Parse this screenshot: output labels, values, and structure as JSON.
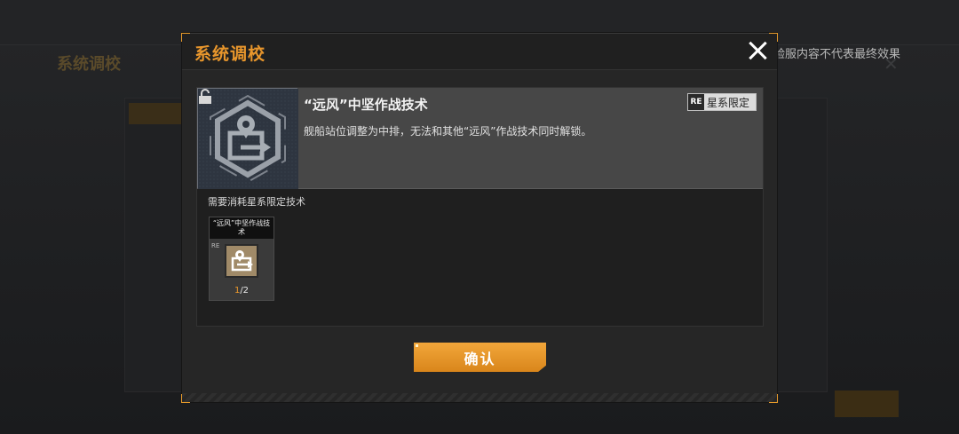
{
  "background": {
    "title": "系统调校",
    "note": "体验服内容不代表最终效果"
  },
  "dialog": {
    "title": "系统调校",
    "tech": {
      "name": "“远风”中坚作战技术",
      "description": "舰船站位调整为中排，无法和其他“远风”作战技术同时解锁。",
      "badge_mark": "RE",
      "badge_text": "星系限定"
    },
    "requirement_label": "需要消耗星系限定技术",
    "item": {
      "name": "“远风”中坚作战技术",
      "mark": "RE",
      "have": "1",
      "need": "/2"
    },
    "confirm_label": "确认"
  },
  "colors": {
    "accent": "#e8962c",
    "button": "#e9972f"
  }
}
